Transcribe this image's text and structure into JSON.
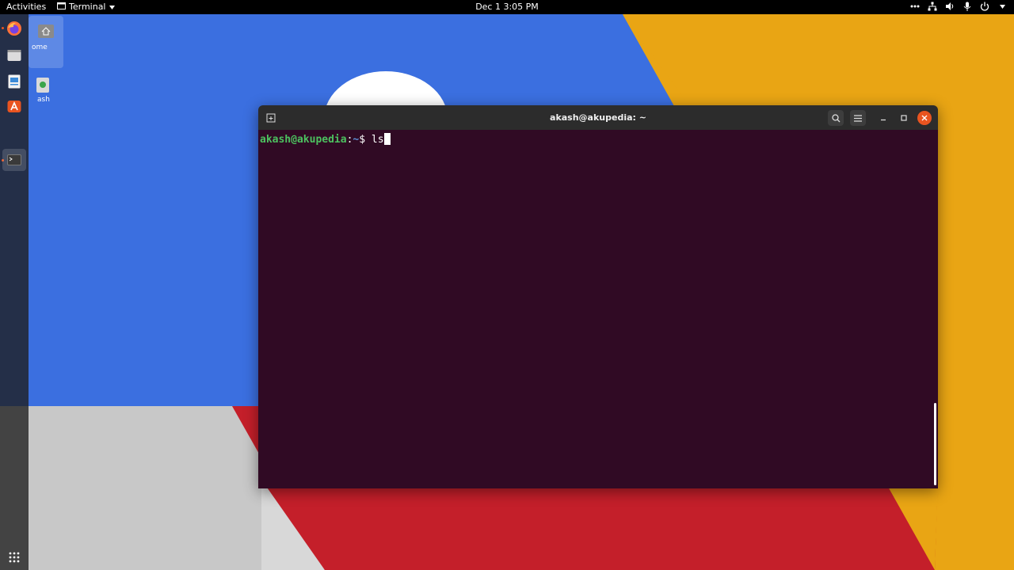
{
  "topbar": {
    "activities_label": "Activities",
    "app_name": "Terminal",
    "clock": "Dec 1  3:05 PM",
    "tray_icons": [
      "overflow-dots-icon",
      "network-icon",
      "volume-icon",
      "microphone-icon",
      "power-icon"
    ]
  },
  "dock": {
    "items": [
      {
        "name": "firefox-icon"
      },
      {
        "name": "files-icon"
      },
      {
        "name": "libreoffice-writer-icon"
      },
      {
        "name": "software-center-icon"
      },
      {
        "name": "terminal-icon"
      }
    ],
    "show_apps_icon": "app-grid-icon"
  },
  "desktop": {
    "icons": [
      {
        "label": "Home",
        "label_visible": "ome",
        "icon": "home-icon"
      },
      {
        "label": "Trash",
        "label_visible": "ash",
        "icon": "trash-icon"
      }
    ]
  },
  "terminal": {
    "title": "akash@akupedia: ~",
    "prompt_user": "akash@akupedia",
    "prompt_sep": ":",
    "prompt_path": "~",
    "prompt_symbol": "$ ",
    "command": "ls"
  },
  "colors": {
    "wallpaper_blue": "#3b6fe0",
    "wallpaper_yellow": "#e9a514",
    "wallpaper_red": "#c41f2a",
    "wallpaper_grey": "#c8c8c8",
    "terminal_bg": "#300a24",
    "prompt_user": "#4cc15f",
    "close_button": "#e95420"
  }
}
